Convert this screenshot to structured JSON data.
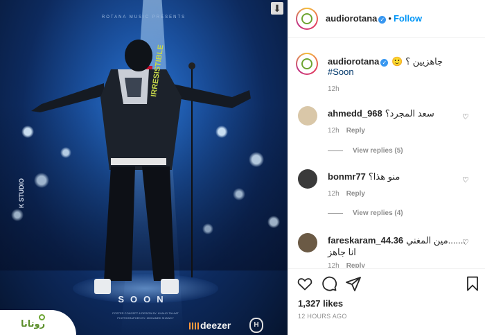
{
  "post_image": {
    "presents_text": "ROTANA MUSIC PRESENTS",
    "studio_text": "K STUDIO",
    "soon_text": "SOON",
    "credits_line1": "POSTER CONCEPT & DESIGN BY: KHALID TALAAT",
    "credits_line2": "PHOTOGRAPHED BY: MOHAMED SHAWKY",
    "jacket_text": "IRRESISTIBLE",
    "brand_logo_text": "روتانا",
    "deezer_text": "deezer",
    "crest_text": "H",
    "download_icon": "download-icon"
  },
  "header": {
    "username": "audiorotana",
    "separator": "•",
    "follow_label": "Follow"
  },
  "caption": {
    "username": "audiorotana",
    "text": "جاهزيين ؟ 🙂",
    "hashtag": "#Soon",
    "time": "12h"
  },
  "comments": [
    {
      "username": "ahmedd_968",
      "text": "سعد المجرد؟",
      "time": "12h",
      "reply_label": "Reply",
      "view_replies": "View replies (5)",
      "avatar_color": "#d9c7a8"
    },
    {
      "username": "bonmr77",
      "text": "منو هذا؟",
      "time": "12h",
      "reply_label": "Reply",
      "view_replies": "View replies (4)",
      "avatar_color": "#3a3a3a"
    },
    {
      "username": "fareskaram_44.36",
      "text": "مين المغني.......",
      "text2": "انا جاهز",
      "time": "12h",
      "reply_label": "Reply",
      "avatar_color": "#6b5a45"
    }
  ],
  "actions": {
    "likes": "1,327 likes",
    "date": "12 HOURS AGO"
  },
  "colors": {
    "accent": "#0095f6",
    "verified": "#3897f0",
    "muted": "#8e8e8e"
  }
}
